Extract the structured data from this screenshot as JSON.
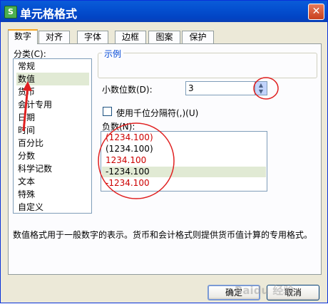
{
  "window": {
    "icon_text": "S",
    "title": "单元格格式",
    "close_glyph": "✕"
  },
  "tabs": [
    {
      "label": "数字",
      "active": true
    },
    {
      "label": "对齐",
      "active": false
    },
    {
      "label": "字体",
      "active": false
    },
    {
      "label": "边框",
      "active": false
    },
    {
      "label": "图案",
      "active": false
    },
    {
      "label": "保护",
      "active": false
    }
  ],
  "category": {
    "label": "分类(C):",
    "items": [
      "常规",
      "数值",
      "货币",
      "会计专用",
      "日期",
      "时间",
      "百分比",
      "分数",
      "科学记数",
      "文本",
      "特殊",
      "自定义"
    ],
    "selected": "数值"
  },
  "sample": {
    "label": "示例",
    "value": ""
  },
  "decimal": {
    "label": "小数位数(D):",
    "value": "3"
  },
  "separator": {
    "label": "使用千位分隔符(,)(U)",
    "checked": false
  },
  "negative": {
    "label": "负数(N):",
    "items": [
      {
        "text": "(1234.100)",
        "color": "#cc0000"
      },
      {
        "text": "(1234.100)",
        "color": "#000000"
      },
      {
        "text": "1234.100",
        "color": "#cc0000"
      },
      {
        "text": "-1234.100",
        "color": "#000000"
      },
      {
        "text": "-1234.100",
        "color": "#cc0000"
      }
    ],
    "selected_index": 3
  },
  "description": "数值格式用于一般数字的表示。货币和会计格式则提供货币值计算的专用格式。",
  "buttons": {
    "ok": "确定",
    "cancel": "取消"
  },
  "watermark": "Baidu 经验",
  "colors": {
    "annotation_red": "#e02020",
    "title_blue": "#0450d0"
  }
}
